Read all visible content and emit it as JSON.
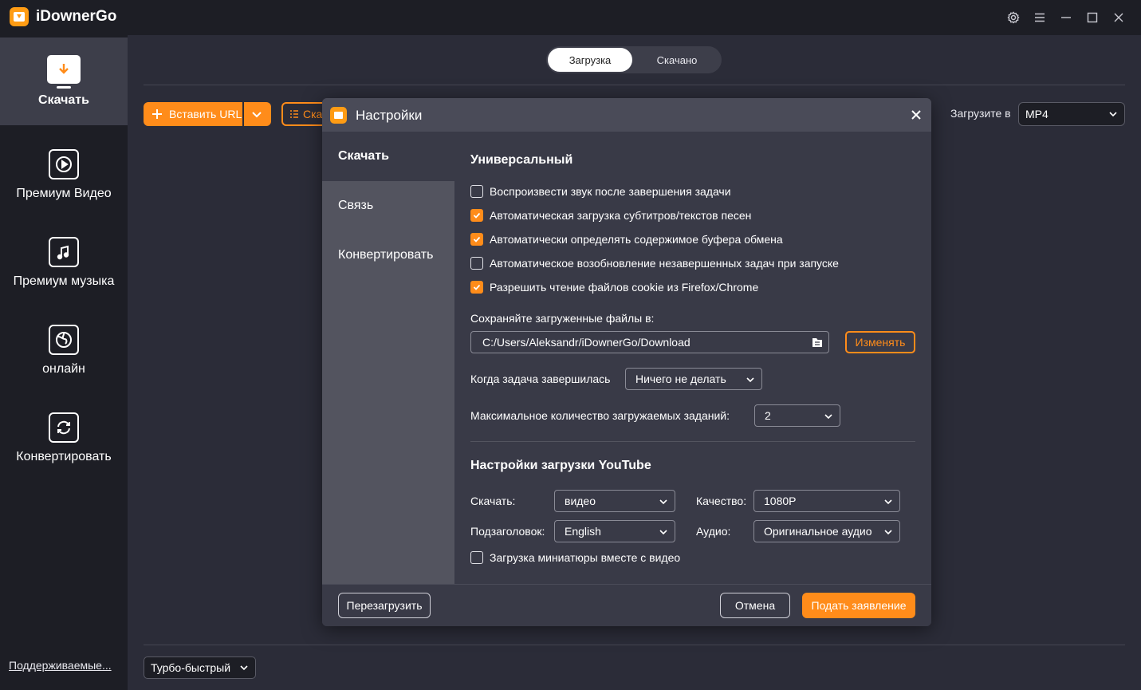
{
  "app": {
    "title": "iDownerGo"
  },
  "sidebar": {
    "items": [
      {
        "label": "Скачать"
      },
      {
        "label": "Премиум Видео"
      },
      {
        "label": "Премиум музыка"
      },
      {
        "label": "онлайн"
      },
      {
        "label": "Конвертировать"
      }
    ],
    "support_link": "Поддерживаемые..."
  },
  "tabs": {
    "download": "Загрузка",
    "downloaded": "Скачано"
  },
  "toolbar": {
    "paste_url": "Вставить URL",
    "second_button_partial": "Ска",
    "format_label": "Загрузите в",
    "format_value": "MP4",
    "speed_value": "Турбо-быстрый"
  },
  "dialog": {
    "title": "Настройки",
    "nav": [
      "Скачать",
      "Связь",
      "Конвертировать"
    ],
    "general": {
      "title": "Универсальный",
      "options": [
        {
          "label": "Воспроизвести звук после завершения задачи",
          "checked": false
        },
        {
          "label": "Автоматическая загрузка субтитров/текстов песен",
          "checked": true
        },
        {
          "label": "Автоматически определять содержимое буфера обмена",
          "checked": true
        },
        {
          "label": "Автоматическое возобновление незавершенных задач при запуске",
          "checked": false
        },
        {
          "label": "Разрешить чтение файлов cookie из Firefox/Chrome",
          "checked": true
        }
      ],
      "save_label": "Сохраняйте загруженные файлы в:",
      "save_path": "C:/Users/Aleksandr/iDownerGo/Download",
      "change_button": "Изменять",
      "on_complete_label": "Когда задача завершилась",
      "on_complete_value": "Ничего не делать",
      "max_tasks_label": "Максимальное количество загружаемых заданий:",
      "max_tasks_value": "2"
    },
    "youtube": {
      "title": "Настройки загрузки YouTube",
      "download_label": "Скачать:",
      "download_value": "видео",
      "quality_label": "Качество:",
      "quality_value": "1080P",
      "subtitle_label": "Подзаголовок:",
      "subtitle_value": "English",
      "audio_label": "Аудио:",
      "audio_value": "Оригинальное аудио",
      "thumbnail_option": "Загрузка миниатюры вместе с видео",
      "thumbnail_checked": false
    },
    "footer": {
      "reset": "Перезагрузить",
      "cancel": "Отмена",
      "submit": "Подать заявление"
    }
  },
  "colors": {
    "accent": "#ff8c1a",
    "sidebar_bg": "#1d1e25",
    "main_bg": "#2b2c38",
    "dialog_bg": "#393a47"
  }
}
